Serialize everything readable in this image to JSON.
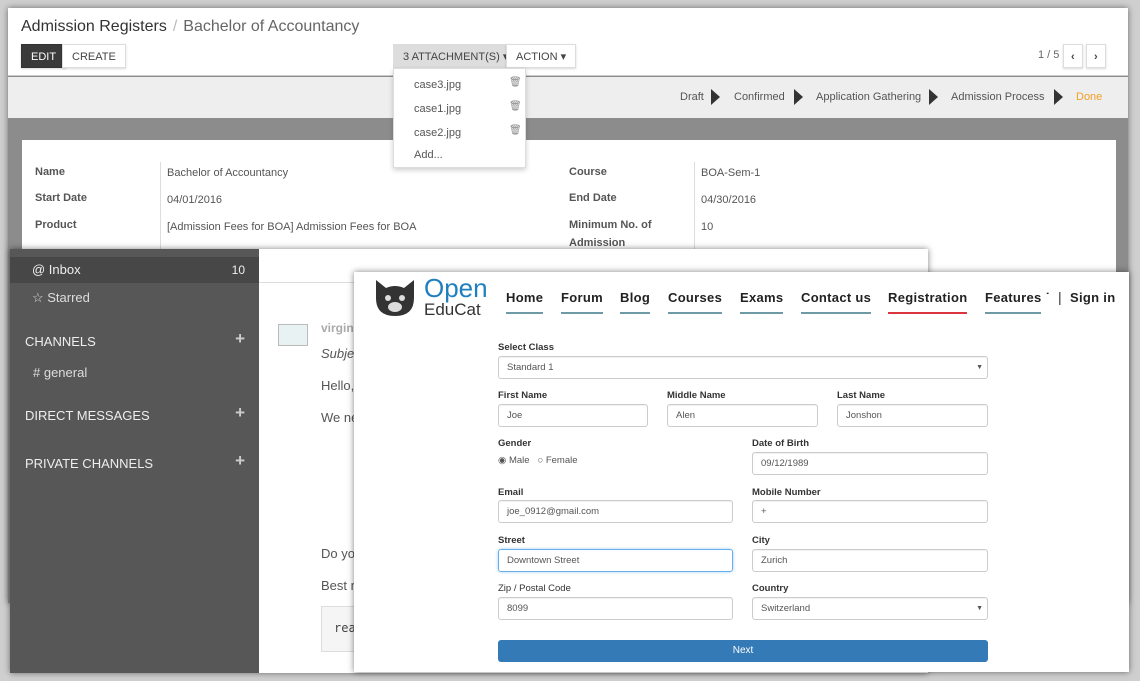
{
  "admission": {
    "breadcrumb_parent": "Admission Registers",
    "breadcrumb_current": "Bachelor of Accountancy",
    "edit": "EDIT",
    "create": "CREATE",
    "attachments": "3 ATTACHMENT(S) ▾",
    "action": "ACTION ▾",
    "attachment_items": [
      "case3.jpg",
      "case1.jpg",
      "case2.jpg"
    ],
    "attachment_add": "Add...",
    "pager": "1 / 5",
    "stages": [
      "Draft",
      "Confirmed",
      "Application Gathering",
      "Admission Process",
      "Done"
    ],
    "active_stage_color": "#f0a023",
    "fields": {
      "name_label": "Name",
      "name": "Bachelor of Accountancy",
      "start_label": "Start Date",
      "start": "04/01/2016",
      "product_label": "Product",
      "product": "[Admission Fees for BOA] Admission Fees for BOA",
      "course_label": "Course",
      "course": "BOA-Sem-1",
      "end_label": "End Date",
      "end": "04/30/2016",
      "min_label": "Minimum No. of Admission",
      "min": "10"
    }
  },
  "discuss": {
    "inbox": "@ Inbox",
    "inbox_count": "10",
    "starred": "☆ Starred",
    "channels": "CHANNELS",
    "general": "# general",
    "direct": "DIRECT MESSAGES",
    "private": "PRIVATE CHANNELS",
    "mail": {
      "author": "virgin",
      "subject": "Subje",
      "hello": "Hello,",
      "we": "We ne",
      "do": "Do yo",
      "best": "Best r",
      "code": "rea"
    }
  },
  "educat": {
    "logo_top": "Open",
    "logo_bottom": "EduCat",
    "nav": [
      "Home",
      "Forum",
      "Blog",
      "Courses",
      "Exams",
      "Contact us",
      "Registration",
      "Features ˙"
    ],
    "signin": "Sign in",
    "active_color": "#d9363e",
    "form": {
      "class_label": "Select Class",
      "class": "Standard 1",
      "first_label": "First Name",
      "first": "Joe",
      "middle_label": "Middle Name",
      "middle": "Alen",
      "last_label": "Last Name",
      "last": "Jonshon",
      "gender_label": "Gender",
      "male": "Male",
      "female": "Female",
      "dob_label": "Date of Birth",
      "dob": "09/12/1989",
      "email_label": "Email",
      "email": "joe_0912@gmail.com",
      "mobile_label": "Mobile Number",
      "mobile": "+",
      "street_label": "Street",
      "street": "Downtown Street",
      "city_label": "City",
      "city": "Zurich",
      "zip_label": "Zip / Postal Code",
      "zip": "8099",
      "country_label": "Country",
      "country": "Switzerland",
      "next": "Next"
    }
  }
}
